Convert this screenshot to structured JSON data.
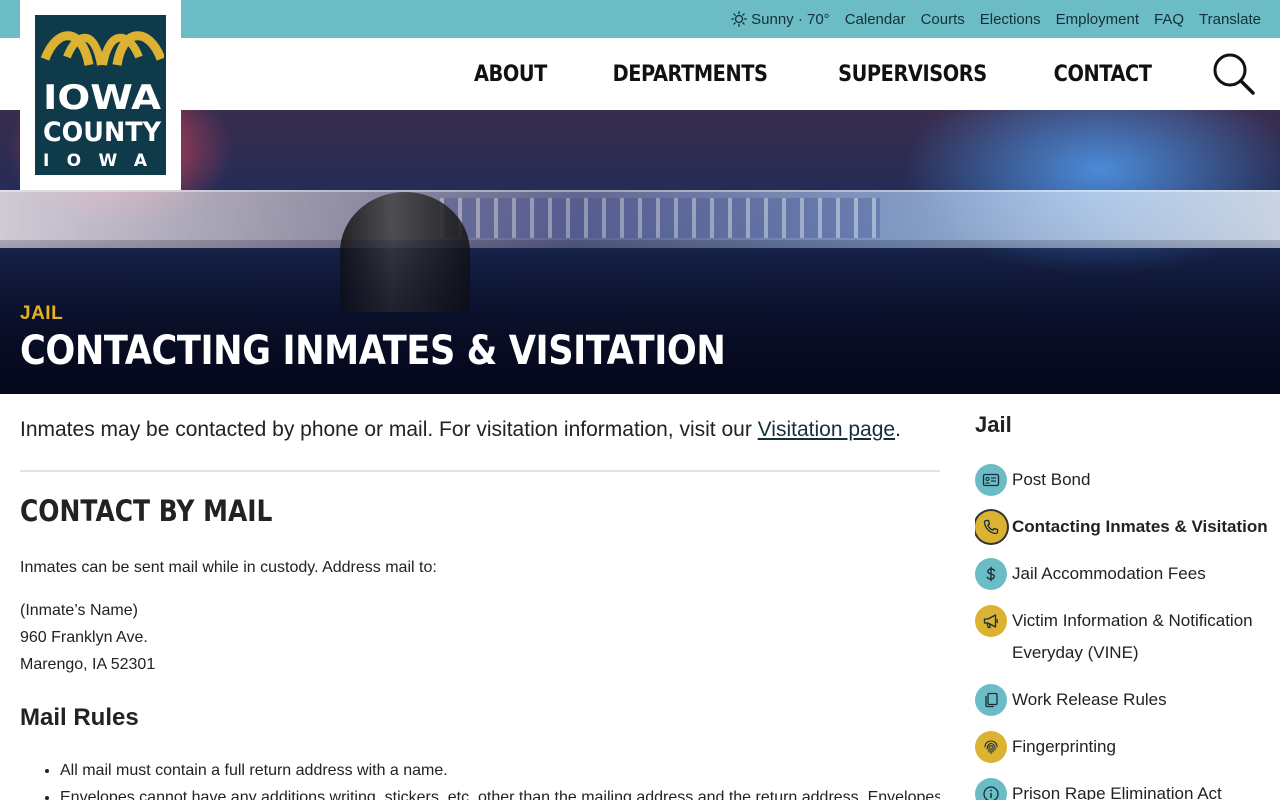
{
  "utility": {
    "weather": "Sunny · 70°",
    "links": [
      "Calendar",
      "Courts",
      "Elections",
      "Employment",
      "FAQ",
      "Translate"
    ]
  },
  "logo": {
    "line1": "IOWA",
    "line2": "COUNTY",
    "line3": "IOWA"
  },
  "nav": {
    "items": [
      "About",
      "Departments",
      "Supervisors",
      "Contact"
    ]
  },
  "hero": {
    "eyebrow": "JAIL",
    "title": "Contacting Inmates & Visitation"
  },
  "content": {
    "intro_text": "Inmates may be contacted by phone or mail. For visitation information, visit our ",
    "intro_link": "Visitation page",
    "intro_end": ".",
    "section_heading": "Contact by Mail",
    "mail_intro": "Inmates can be sent mail while in custody. Address mail to:",
    "address": [
      "(Inmate’s Name)",
      "960 Franklyn Ave.",
      "Marengo, IA 52301"
    ],
    "rules_heading": "Mail Rules",
    "rules": [
      "All mail must contain a full return address with a name.",
      "Envelopes cannot have any additions writing, stickers, etc. other than the mailing address and the return address. Envelopes"
    ]
  },
  "sidebar": {
    "title": "Jail",
    "items": [
      {
        "label": "Post Bond",
        "icon": "id-card-icon",
        "color": "teal"
      },
      {
        "label": "Contacting Inmates & Visitation",
        "icon": "phone-icon",
        "color": "gold",
        "active": true
      },
      {
        "label": "Jail Accommodation Fees",
        "icon": "dollar-icon",
        "color": "teal"
      },
      {
        "label": "Victim Information & Notification Everyday (VINE)",
        "icon": "megaphone-icon",
        "color": "gold"
      },
      {
        "label": "Work Release Rules",
        "icon": "copy-icon",
        "color": "teal"
      },
      {
        "label": "Fingerprinting",
        "icon": "fingerprint-icon",
        "color": "gold"
      },
      {
        "label": "Prison Rape Elimination Act",
        "icon": "info-icon",
        "color": "teal"
      }
    ]
  },
  "colors": {
    "utility_bar": "#6cbcc5",
    "brand_navy": "#0f3a4a",
    "accent_gold": "#dcb233",
    "eyebrow_gold": "#e6b320"
  }
}
